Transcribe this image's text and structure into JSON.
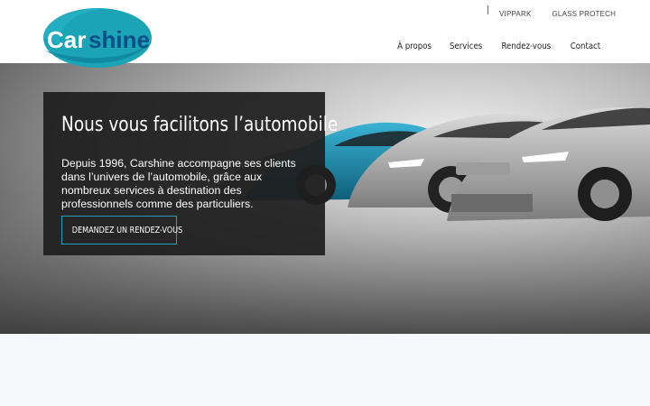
{
  "brand": {
    "name_part1": "Car",
    "name_part2": "shine",
    "colors": {
      "teal": "#1ba3b6",
      "navy": "#0a4f86"
    }
  },
  "top_links": [
    {
      "label": "VIPPARK"
    },
    {
      "label": "GLASS PROTECH"
    }
  ],
  "nav": [
    {
      "label": "À propos"
    },
    {
      "label": "Services"
    },
    {
      "label": "Rendez-vous"
    },
    {
      "label": "Contact"
    }
  ],
  "hero": {
    "title": "Nous vous facilitons l’automobile",
    "text": "Depuis 1996, Carshine accompagne ses clients dans l’univers de l’automobile, grâce aux nombreux services à destination des professionnels comme des particuliers.",
    "cta_label": "DEMANDEZ UN RENDEZ-VOUS",
    "accent_color": "#1fa3b8"
  }
}
